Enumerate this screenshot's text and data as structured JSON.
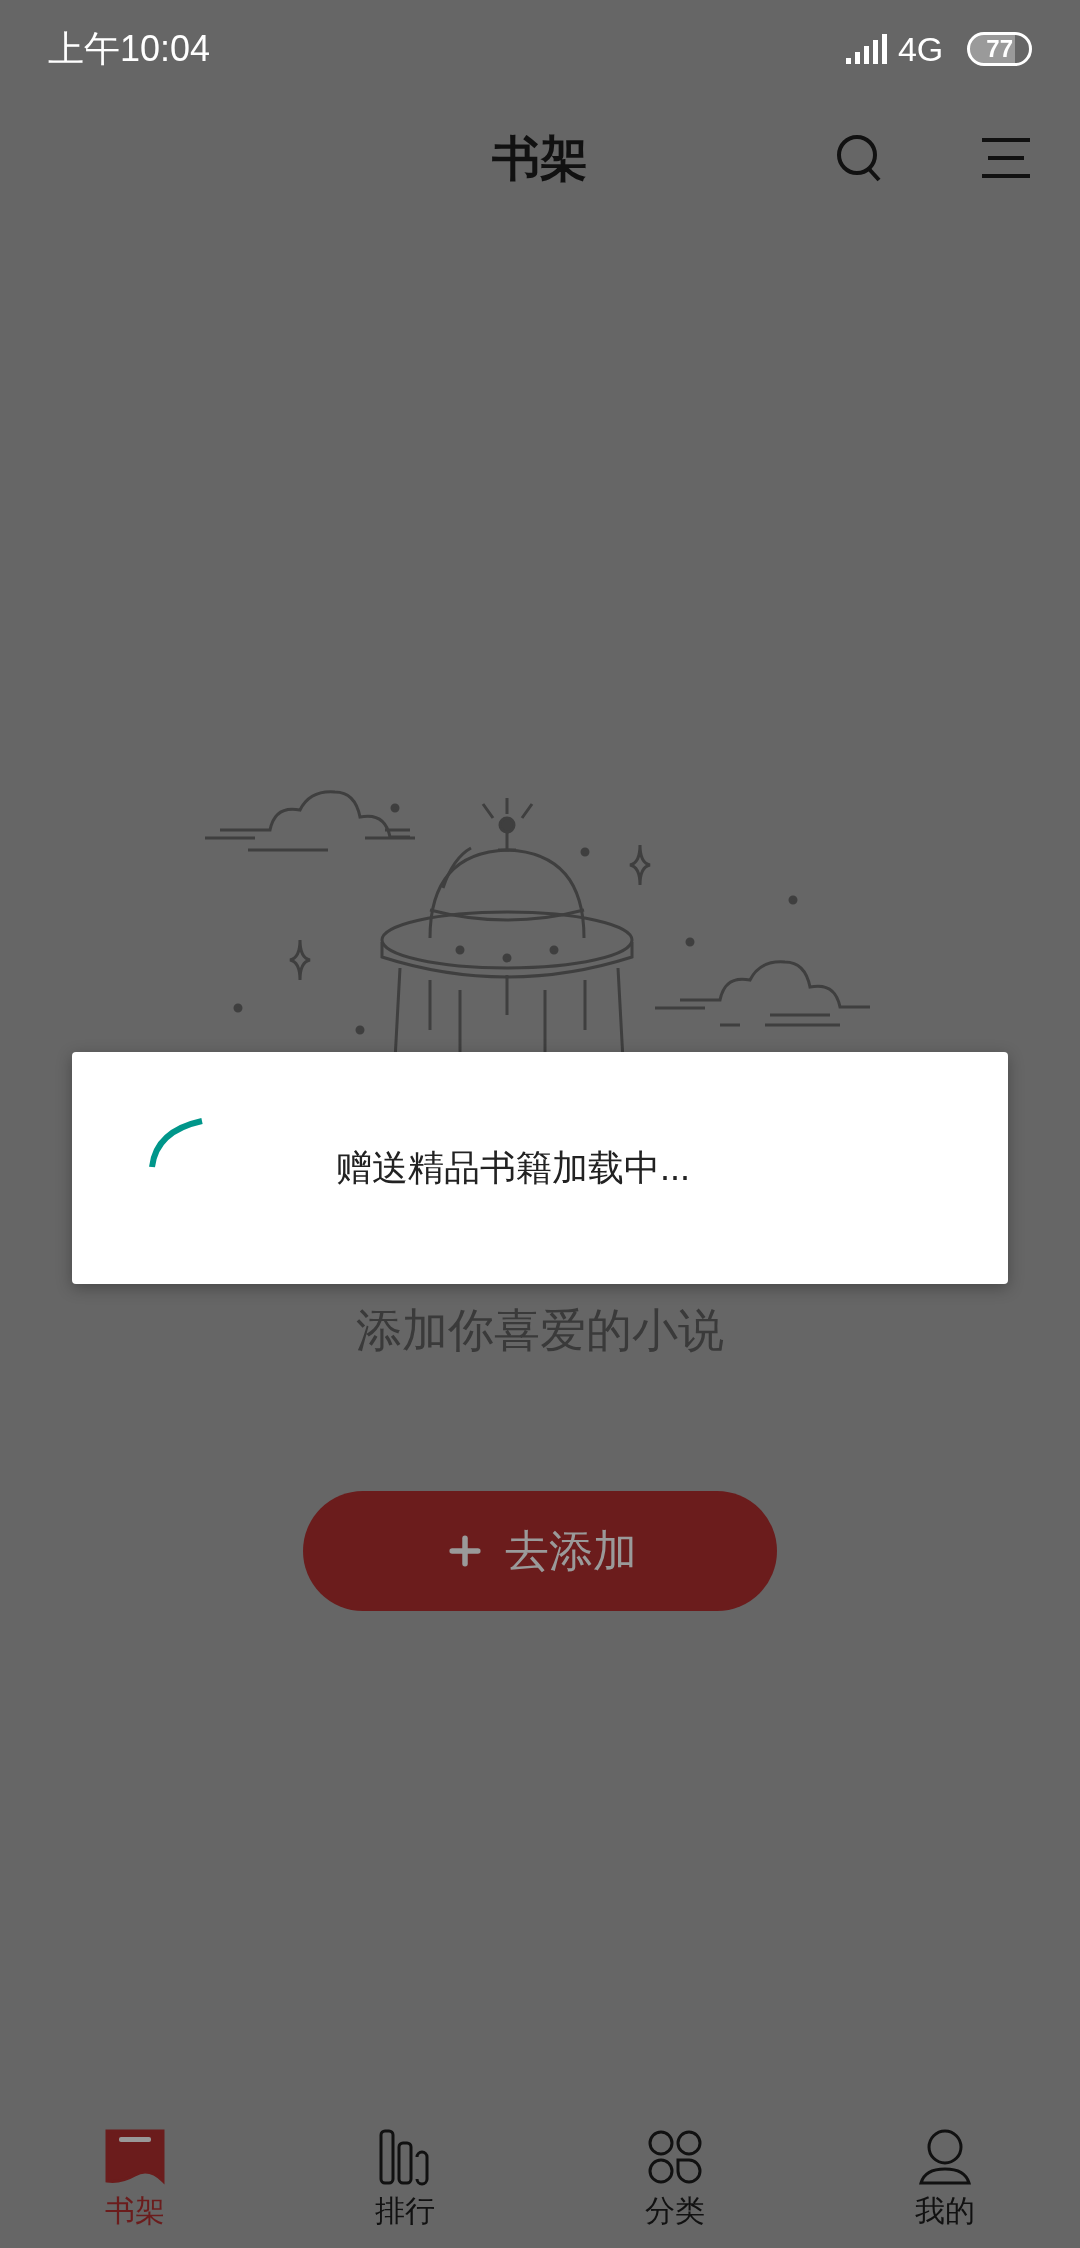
{
  "status_bar": {
    "time": "上午10:04",
    "network": "4G",
    "battery": "77"
  },
  "header": {
    "title": "书架"
  },
  "empty_state": {
    "message": "添加你喜爱的小说",
    "button_label": "去添加"
  },
  "dialog": {
    "message": "赠送精品书籍加载中..."
  },
  "tabs": [
    {
      "kind": "bookshelf",
      "label": "书架",
      "selected": true
    },
    {
      "kind": "ranking",
      "label": "排行",
      "selected": false
    },
    {
      "kind": "category",
      "label": "分类",
      "selected": false
    },
    {
      "kind": "profile",
      "label": "我的",
      "selected": false
    }
  ]
}
